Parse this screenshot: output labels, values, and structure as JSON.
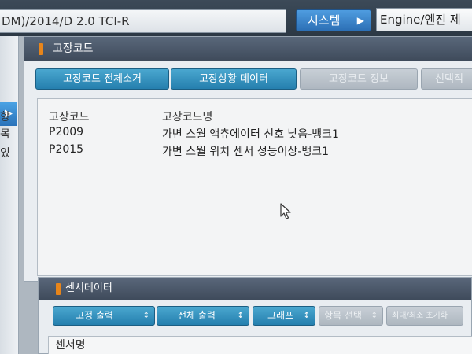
{
  "header": {
    "vehicle": "DM)/2014/D 2.0 TCI-R",
    "system_button": "시스템",
    "system_value": "Engine/엔진 제"
  },
  "left_strip": {
    "chars": [
      "항",
      "목",
      "있"
    ]
  },
  "dtc_panel": {
    "title": "고장코드",
    "buttons": [
      {
        "label": "고장코드 전체소거",
        "state": "active"
      },
      {
        "label": "고장상황 데이터",
        "state": "active"
      },
      {
        "label": "고장코드 정보",
        "state": "disabled"
      },
      {
        "label": "선택적",
        "state": "disabled"
      }
    ],
    "columns": {
      "code": "고장코드",
      "name": "고장코드명"
    },
    "rows": [
      {
        "code": "P2009",
        "name": "가변 스월 액츄에이터 신호 낮음-뱅크1"
      },
      {
        "code": "P2015",
        "name": "가변 스월 위치 센서 성능이상-뱅크1"
      }
    ]
  },
  "sensor_panel": {
    "title": "센서데이터",
    "buttons": [
      {
        "label": "고정 출력",
        "state": "active"
      },
      {
        "label": "전체 출력",
        "state": "active"
      },
      {
        "label": "그래프",
        "state": "active"
      },
      {
        "label": "항목 선택",
        "state": "disabled"
      },
      {
        "label": "최대/최소 초기화",
        "state": "disabled"
      }
    ],
    "column_header": "센서명"
  },
  "icons": {
    "right_arrow": "chevron-right-icon",
    "updown": "updown-arrow-icon",
    "cursor": "mouse-pointer-icon"
  },
  "colors": {
    "accent_blue": "#2c7fb0",
    "title_bar": "#4a5768",
    "marker_orange": "#e8851a"
  }
}
